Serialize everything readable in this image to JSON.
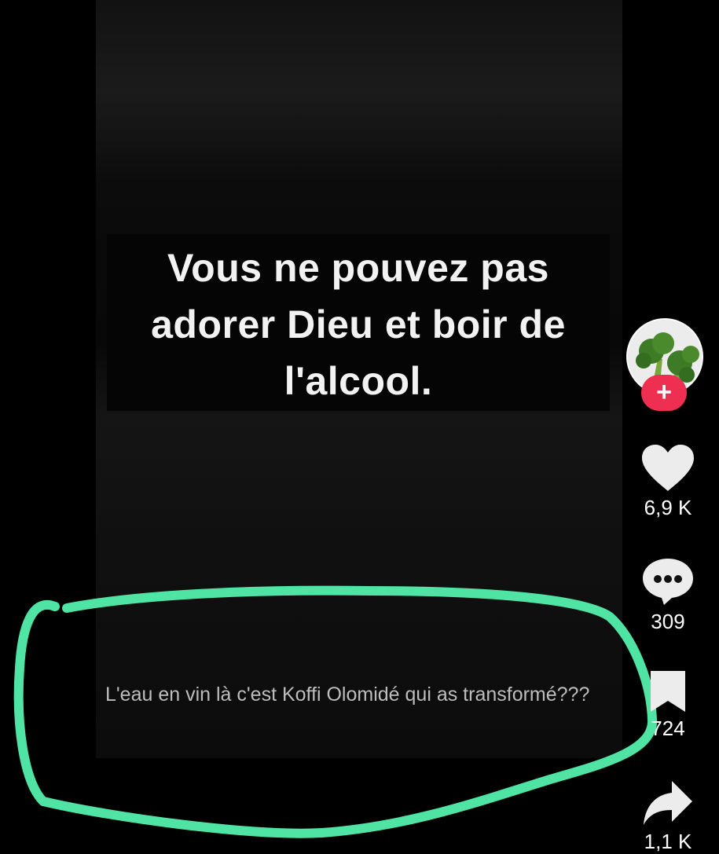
{
  "video": {
    "headline": "Vous ne pouvez pas adorer Dieu et boir de l'alcool.",
    "caption": "L'eau en vin là c'est Koffi  Olomidé qui as transformé???"
  },
  "sidebar": {
    "follow_label": "+",
    "likes": "6,9 K",
    "comments": "309",
    "bookmarks": "724",
    "shares": "1,1 K"
  },
  "colors": {
    "highlight": "#4fe3a4",
    "follow": "#ee2f52"
  },
  "icons": [
    "heart-icon",
    "comment-icon",
    "bookmark-icon",
    "share-icon",
    "plus-icon"
  ]
}
